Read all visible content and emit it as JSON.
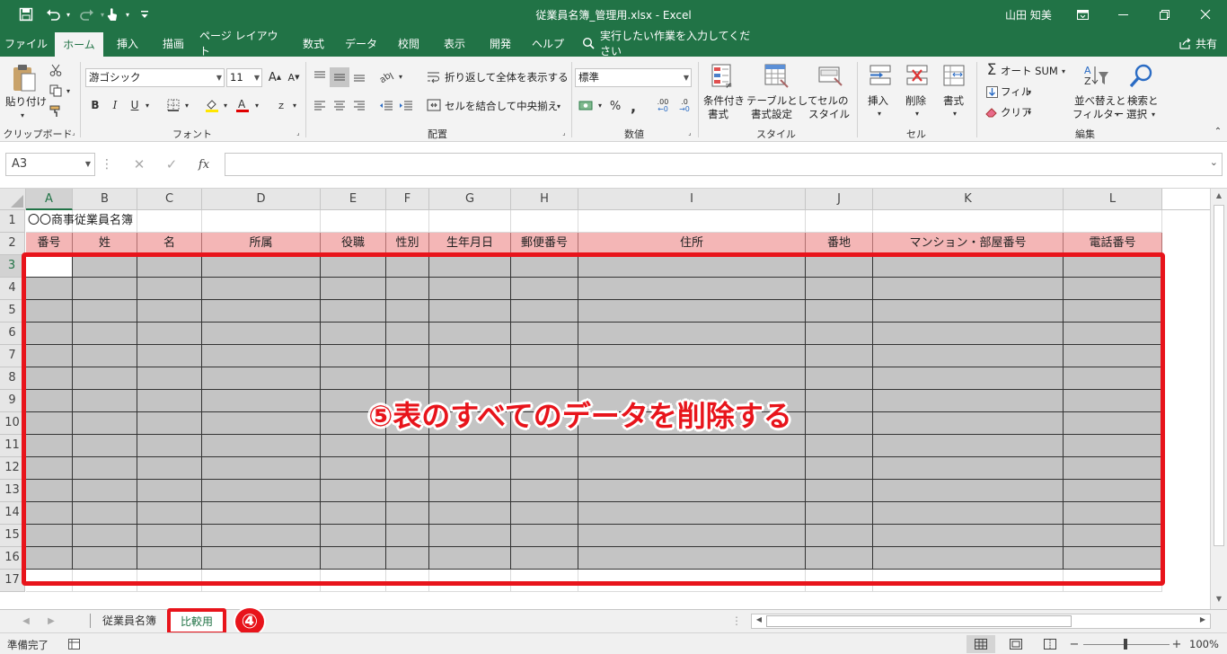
{
  "titlebar": {
    "document_title": "従業員名簿_管理用.xlsx  -  Excel",
    "user_name": "山田 知美",
    "icons": [
      "save-icon",
      "undo-icon",
      "redo-icon",
      "touch-mode-icon",
      "customize-qat-icon",
      "ribbon-display-icon",
      "minimize-icon",
      "restore-icon",
      "close-icon"
    ]
  },
  "tabs": {
    "file": "ファイル",
    "home": "ホーム",
    "insert": "挿入",
    "draw": "描画",
    "page_layout": "ページ レイアウト",
    "formulas": "数式",
    "data": "データ",
    "review": "校閲",
    "view": "表示",
    "developer": "開発",
    "help": "ヘルプ",
    "tell_me": "実行したい作業を入力してください",
    "share": "共有"
  },
  "ribbon": {
    "clipboard": {
      "paste": "貼り付け",
      "group": "クリップボード"
    },
    "font": {
      "name": "游ゴシック",
      "size": "11",
      "bold": "B",
      "italic": "I",
      "underline": "U",
      "group": "フォント"
    },
    "alignment": {
      "wrap_text": "折り返して全体を表示する",
      "merge_center": "セルを結合して中央揃え",
      "group": "配置"
    },
    "number": {
      "format": "標準",
      "percent": "%",
      "comma": ",",
      "inc_decimal": ".00",
      "dec_decimal": ".0",
      "group": "数値"
    },
    "styles": {
      "conditional_1": "条件付き",
      "conditional_2": "書式",
      "table_1": "テーブルとして",
      "table_2": "書式設定",
      "cell_1": "セルの",
      "cell_2": "スタイル",
      "group": "スタイル"
    },
    "cells": {
      "insert": "挿入",
      "delete": "削除",
      "format": "書式",
      "group": "セル"
    },
    "editing": {
      "autosum": "オート SUM",
      "fill": "フィル",
      "clear": "クリア",
      "sort_1": "並べ替えと",
      "sort_2": "フィルター",
      "find_1": "検索と",
      "find_2": "選択",
      "group": "編集"
    }
  },
  "formula_bar": {
    "name_box": "A3",
    "fx": "fx",
    "value": ""
  },
  "grid": {
    "columns": [
      "A",
      "B",
      "C",
      "D",
      "E",
      "F",
      "G",
      "H",
      "I",
      "J",
      "K",
      "L"
    ],
    "rows": [
      "1",
      "2",
      "3",
      "4",
      "5",
      "6",
      "7",
      "8",
      "9",
      "10",
      "11",
      "12",
      "13",
      "14",
      "15",
      "16",
      "17"
    ],
    "title_cell": "〇〇商事従業員名簿",
    "headers": [
      "番号",
      "姓",
      "名",
      "所属",
      "役職",
      "性別",
      "生年月日",
      "郵便番号",
      "住所",
      "番地",
      "マンション・部屋番号",
      "電話番号"
    ]
  },
  "annotations": {
    "instruction": "⑤表のすべてのデータを削除する",
    "step_marker": "④"
  },
  "sheets": {
    "tabs": [
      "従業員名簿",
      "比較用"
    ],
    "active": "比較用"
  },
  "status": {
    "ready": "準備完了",
    "zoom": "100%"
  },
  "colors": {
    "excel_green": "#217346",
    "header_fill": "#f4b6b6",
    "data_fill": "#c4c4c4",
    "annotation_red": "#e8141b"
  }
}
